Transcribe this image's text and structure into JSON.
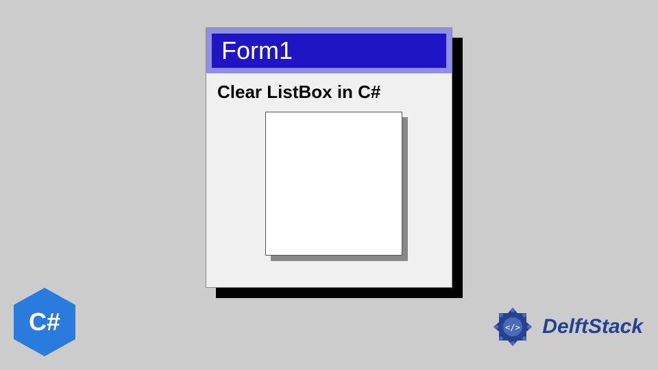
{
  "form": {
    "title": "Form1",
    "heading": "Clear ListBox in C#"
  },
  "badges": {
    "csharp": "C#",
    "brand": "DelftStack"
  }
}
